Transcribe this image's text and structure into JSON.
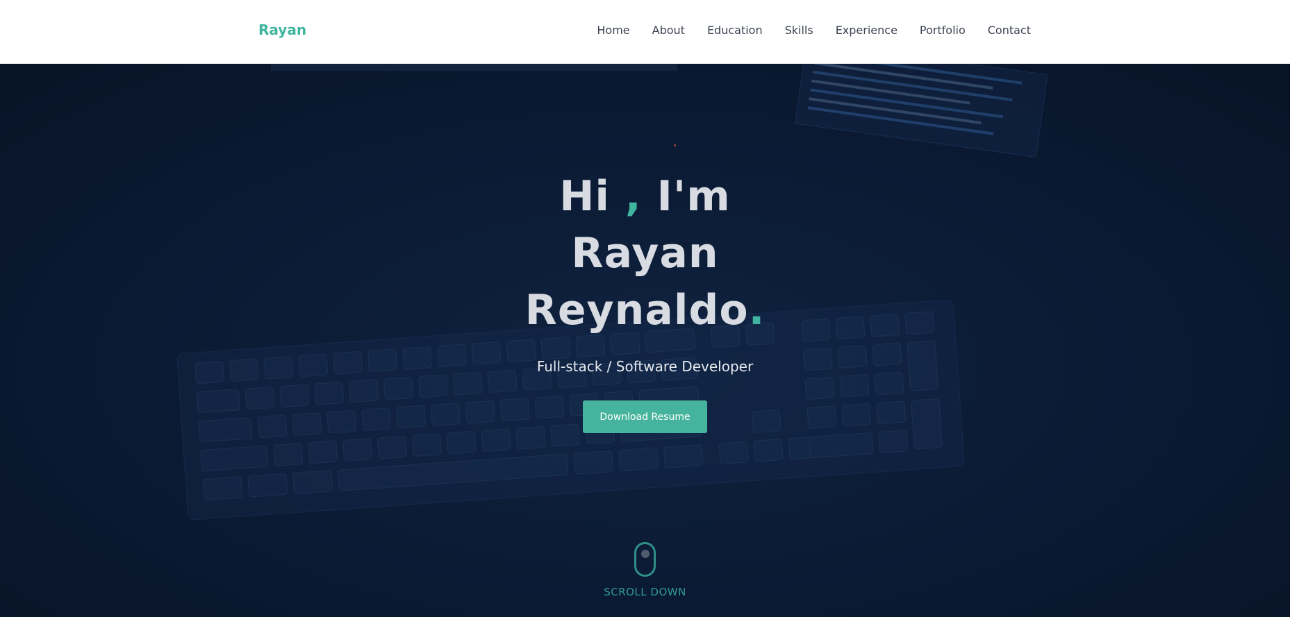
{
  "nav": {
    "brand": "Rayan",
    "links": [
      "Home",
      "About",
      "Education",
      "Skills",
      "Experience",
      "Portfolio",
      "Contact"
    ]
  },
  "hero": {
    "line1_a": "Hi ",
    "line1_comma": ",",
    "line1_b": " I'm",
    "line2": "Rayan",
    "line3": "Reynaldo",
    "line3_dot": ".",
    "subtitle": "Full-stack / Software Developer",
    "cta_label": "Download Resume",
    "scroll_label": "SCROLL DOWN"
  },
  "colors": {
    "accent": "#3fb59f",
    "background": "#0b1a33",
    "nav_bg": "#ffffff",
    "button": "#45b39d"
  }
}
